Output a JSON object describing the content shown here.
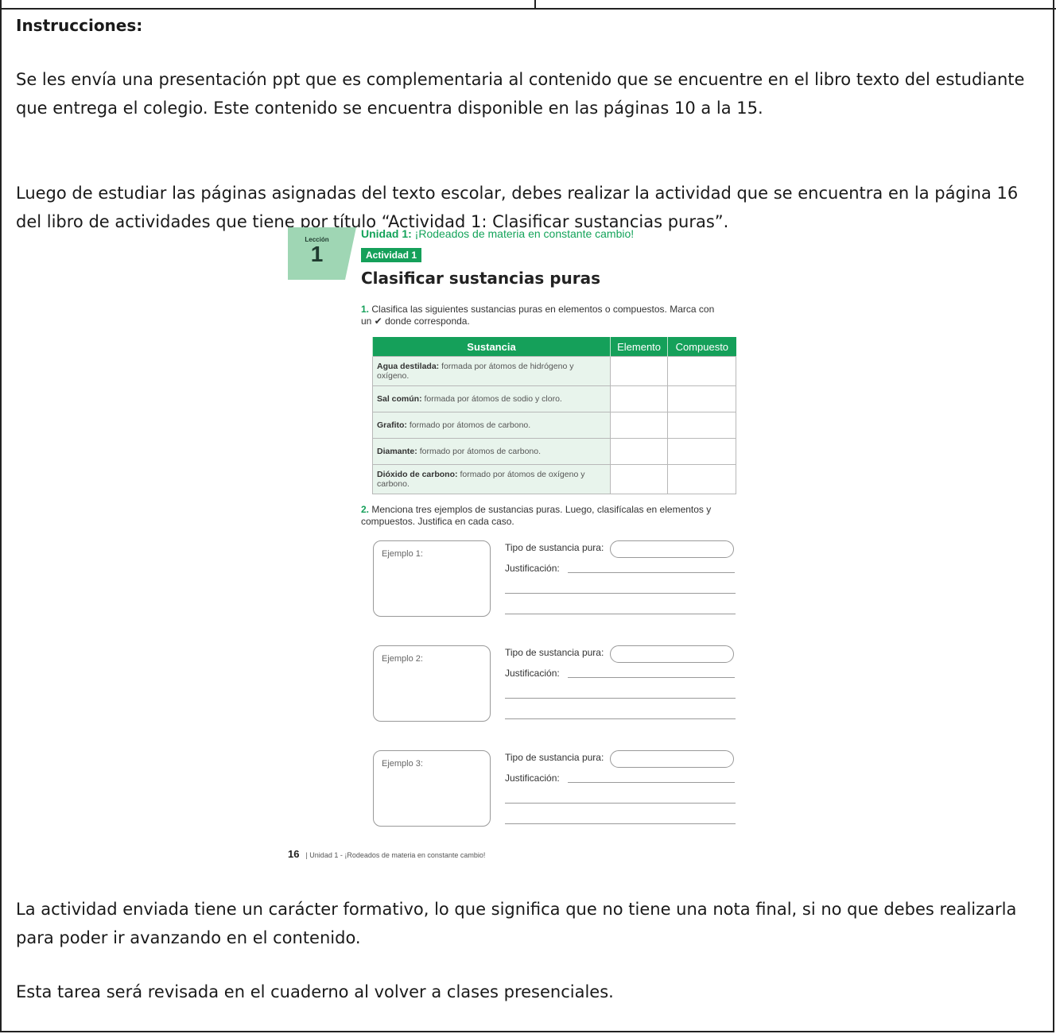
{
  "heading": "Instrucciones:",
  "paragraph1": "Se les envía una presentación ppt que es complementaria al contenido que se encuentre en el libro texto del estudiante que entrega el colegio. Este contenido se encuentra disponible en las páginas 10 a la 15.",
  "paragraph2": "Luego de estudiar las páginas asignadas del texto escolar, debes realizar la actividad que se encuentra en la página 16 del libro de actividades que tiene por título “Actividad 1: Clasificar sustancias puras”.",
  "paragraph3": "La actividad enviada tiene un carácter formativo, lo que significa que no tiene una nota final, si no que debes realizarla para poder ir avanzando en el contenido.",
  "paragraph4": "Esta tarea será revisada en el cuaderno al volver a clases presenciales.",
  "book": {
    "lesson_word": "Lección",
    "lesson_number": "1",
    "unit_prefix": "Unidad 1:",
    "unit_title": "¡Rodeados de materia en constante cambio!",
    "activity_badge": "Actividad 1",
    "activity_title": "Clasificar sustancias puras",
    "q1_number": "1.",
    "q1_text": "Clasifica las siguientes sustancias puras en elementos o compuestos. Marca con un ✔ donde corresponda.",
    "table_headers": [
      "Sustancia",
      "Elemento",
      "Compuesto"
    ],
    "rows": [
      {
        "name": "Agua destilada:",
        "desc": "formada por átomos de hidrógeno y oxígeno."
      },
      {
        "name": "Sal común:",
        "desc": "formada por átomos de sodio y cloro."
      },
      {
        "name": "Grafito:",
        "desc": "formado por átomos de carbono."
      },
      {
        "name": "Diamante:",
        "desc": "formado por átomos de carbono."
      },
      {
        "name": "Dióxido de carbono:",
        "desc": "formado por átomos de oxígeno y carbono."
      }
    ],
    "q2_number": "2.",
    "q2_text": "Menciona tres ejemplos de sustancias puras. Luego, clasifícalas en elementos y compuestos. Justifica en cada caso.",
    "examples": [
      "Ejemplo 1:",
      "Ejemplo 2:",
      "Ejemplo 3:"
    ],
    "type_label": "Tipo de sustancia pura:",
    "justification_label": "Justificación:",
    "footer_page": "16",
    "footer_text": "| Unidad 1 - ¡Rodeados de materia en constante cambio!"
  },
  "colors": {
    "accent_green": "#15a05a",
    "table_row_fill": "#e8f4ec",
    "lesson_tab": "#9fd6b4"
  }
}
